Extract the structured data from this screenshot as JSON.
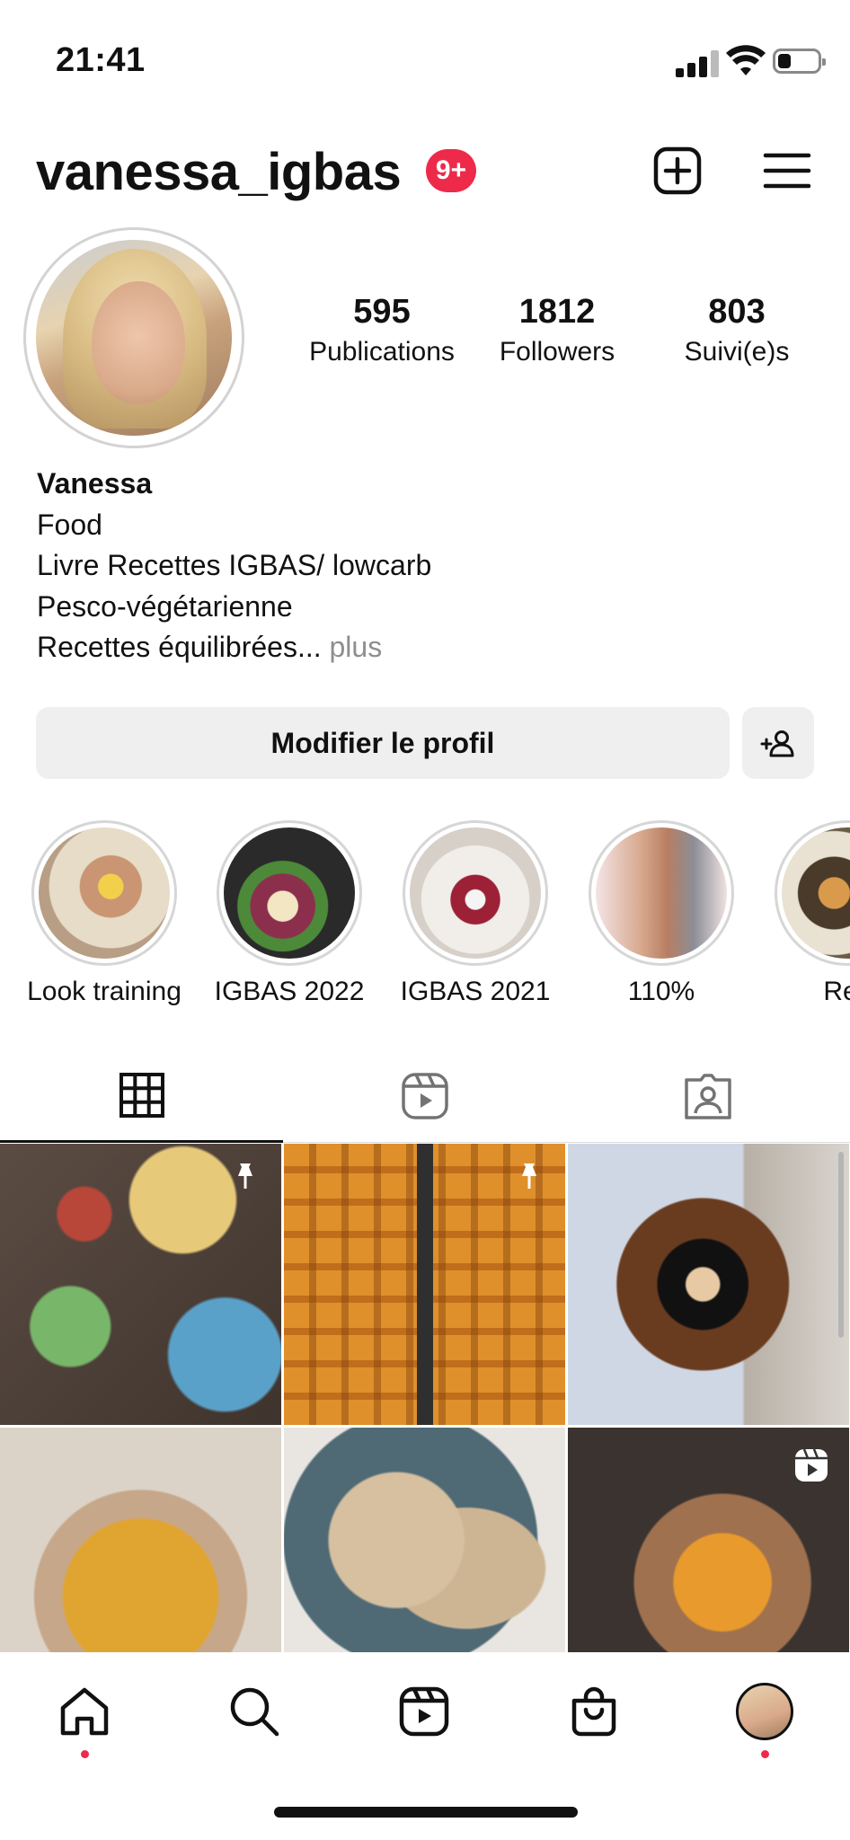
{
  "status_bar": {
    "time": "21:41"
  },
  "header": {
    "username": "vanessa_igbas",
    "notification_badge": "9+"
  },
  "stats": [
    {
      "value": "595",
      "label": "Publications"
    },
    {
      "value": "1812",
      "label": "Followers"
    },
    {
      "value": "803",
      "label": "Suivi(e)s"
    }
  ],
  "bio": {
    "name": "Vanessa",
    "lines": [
      "Food",
      "Livre Recettes IGBAS/ lowcarb",
      "Pesco-végétarienne"
    ],
    "last_line": "Recettes équilibrées...",
    "more": "plus"
  },
  "actions": {
    "edit_profile": "Modifier le profil"
  },
  "highlights": [
    {
      "label": "Look training"
    },
    {
      "label": "IGBAS 2022"
    },
    {
      "label": "IGBAS 2021"
    },
    {
      "label": "110%"
    },
    {
      "label": "Res"
    }
  ],
  "tabs": [
    "grid-icon",
    "reels-icon",
    "tagged-icon"
  ],
  "colors": {
    "badge": "#ee2a4a",
    "button_bg": "#efefef",
    "accent_text": "#111111"
  }
}
